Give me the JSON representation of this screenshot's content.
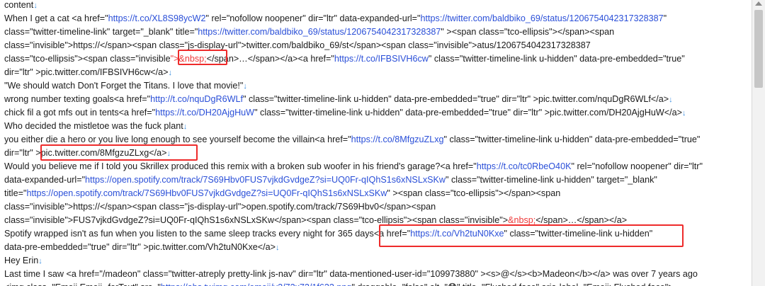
{
  "mark": "↓",
  "lines": [
    [
      {
        "t": "content"
      },
      {
        "t": "↓",
        "c": "m"
      }
    ],
    [
      {
        "t": "When I get a cat <a href=\""
      },
      {
        "t": "https://t.co/XL8S98ycW2",
        "c": "l"
      },
      {
        "t": "\" rel=\"nofollow noopener\" dir=\"ltr\" data-expanded-url=\""
      },
      {
        "t": "https://twitter.com/baldbiko_69/status/1206754042317328387",
        "c": "l"
      },
      {
        "t": "\""
      }
    ],
    [
      {
        "t": "class=\"twitter-timeline-link\" target=\"_blank\" title=\""
      },
      {
        "t": "https://twitter.com/baldbiko_69/status/1206754042317328387",
        "c": "l"
      },
      {
        "t": "\" ><span class=\"tco-ellipsis\"></span><span"
      }
    ],
    [
      {
        "t": "class=\"invisible\">https://</span><span class=\"js-display-url\">twitter.com/baldbiko_69/st</span><span class=\"invisible\">atus/1206754042317328387"
      }
    ],
    [
      {
        "t": "class=\"tco-ellipsis\"><span class=\"invisible"
      },
      {
        "t": "\">&nbsp;",
        "c": "red"
      },
      {
        "t": "</span>…</span></a><a href=\""
      },
      {
        "t": "https://t.co/IFBSIVH6cw",
        "c": "l"
      },
      {
        "t": "\" class=\"twitter-timeline-link u-hidden\" data-pre-embedded=\"true\""
      }
    ],
    [
      {
        "t": "dir=\"ltr\" >pic.twitter.com/IFBSIVH6cw</a>"
      },
      {
        "t": "↓",
        "c": "m"
      }
    ],
    [
      {
        "t": "\"We should watch Don't Forget the Titans. I love that movie!\""
      },
      {
        "t": "↓",
        "c": "m"
      }
    ],
    [
      {
        "t": "wrong number texting goals<a href=\""
      },
      {
        "t": "http://t.co/nquDgR6WLf",
        "c": "l"
      },
      {
        "t": "\" class=\"twitter-timeline-link u-hidden\" data-pre-embedded=\"true\" dir=\"ltr\" >pic.twitter.com/nquDgR6WLf</a>"
      },
      {
        "t": "↓",
        "c": "m"
      }
    ],
    [
      {
        "t": "chick fil a got mfs out in tents<a href=\""
      },
      {
        "t": "https://t.co/DH20AjgHuW",
        "c": "l"
      },
      {
        "t": "\" class=\"twitter-timeline-link u-hidden\" data-pre-embedded=\"true\" dir=\"ltr\" >pic.twitter.com/DH20AjgHuW</a>"
      },
      {
        "t": "↓",
        "c": "m"
      }
    ],
    [
      {
        "t": "Who decided the mistletoe was the fuck plant"
      },
      {
        "t": "↓",
        "c": "m"
      }
    ],
    [
      {
        "t": "you either die a hero or you live long enough to see yourself become the villain<a href=\""
      },
      {
        "t": "https://t.co/8MfgzuZLxg",
        "c": "l"
      },
      {
        "t": "\" class=\"twitter-timeline-link u-hidden\" data-pre-embedded=\"true\""
      }
    ],
    [
      {
        "t": "dir=\"ltr\" >pic.twitter.com/8MfgzuZLxg</a>"
      },
      {
        "t": "↓",
        "c": "m"
      }
    ],
    [
      {
        "t": "Would you believe me if I told you Skrillex produced this remix with a broken sub woofer in his friend's garage?<a href=\""
      },
      {
        "t": "https://t.co/tc0RbeO40K",
        "c": "l"
      },
      {
        "t": "\" rel=\"nofollow noopener\" dir=\"ltr\""
      }
    ],
    [
      {
        "t": "data-expanded-url=\""
      },
      {
        "t": "https://open.spotify.com/track/7S69Hbv0FUS7vjkdGvdgeZ?si=UQ0Fr-qIQhS1s6xNSLxSKw",
        "c": "l"
      },
      {
        "t": "\" class=\"twitter-timeline-link u-hidden\" target=\"_blank\""
      }
    ],
    [
      {
        "t": "title=\""
      },
      {
        "t": "https://open.spotify.com/track/7S69Hbv0FUS7vjkdGvdgeZ?si=UQ0Fr-qIQhS1s6xNSLxSKw",
        "c": "l"
      },
      {
        "t": "\" ><span class=\"tco-ellipsis\"></span><span"
      }
    ],
    [
      {
        "t": "class=\"invisible\">https://</span><span class=\"js-display-url\">open.spotify.com/track/7S69Hbv0</span><span"
      }
    ],
    [
      {
        "t": "class=\"invisible\">FUS7vjkdGvdgeZ?si=UQ0Fr-qIQhS1s6xNSLxSKw</span><span class=\"tco-ellipsis\"><span class=\"invisible\">"
      },
      {
        "t": "&nbsp;",
        "c": "red"
      },
      {
        "t": "</span>…</span></a>"
      }
    ],
    [
      {
        "t": "Spotify wrapped isn't as fun when you listen to the same sleep tracks every night for 365 days<a href=\""
      },
      {
        "t": "https://t.co/Vh2tuN0Kxe",
        "c": "l"
      },
      {
        "t": "\" class=\"twitter-timeline-link u-hidden\""
      }
    ],
    [
      {
        "t": "data-pre-embedded=\"true\" dir=\"ltr\" >pic.twitter.com/Vh2tuN0Kxe</a>"
      },
      {
        "t": "↓",
        "c": "m"
      }
    ],
    [
      {
        "t": "Hey Erin"
      },
      {
        "t": "↓",
        "c": "m"
      }
    ],
    [
      {
        "t": "Last time I saw <a href=\"/madeon\" class=\"twitter-atreply pretty-link js-nav\" dir=\"ltr\" data-mentioned-user-id=\"109973880\" ><s>@</s><b>Madeon</b></a> was over 7 years ago"
      }
    ],
    [
      {
        "t": "<img class=\"Emoji Emoji--forText\" src=\""
      },
      {
        "t": "https://abs.twimg.com/emoji/v2/72x72/1f633.png",
        "c": "l"
      },
      {
        "t": "\" draggable=\"false\" alt=\"😳\" title=\"Flushed face\" aria-label=\"Emoji: Flushed face\">"
      }
    ]
  ]
}
